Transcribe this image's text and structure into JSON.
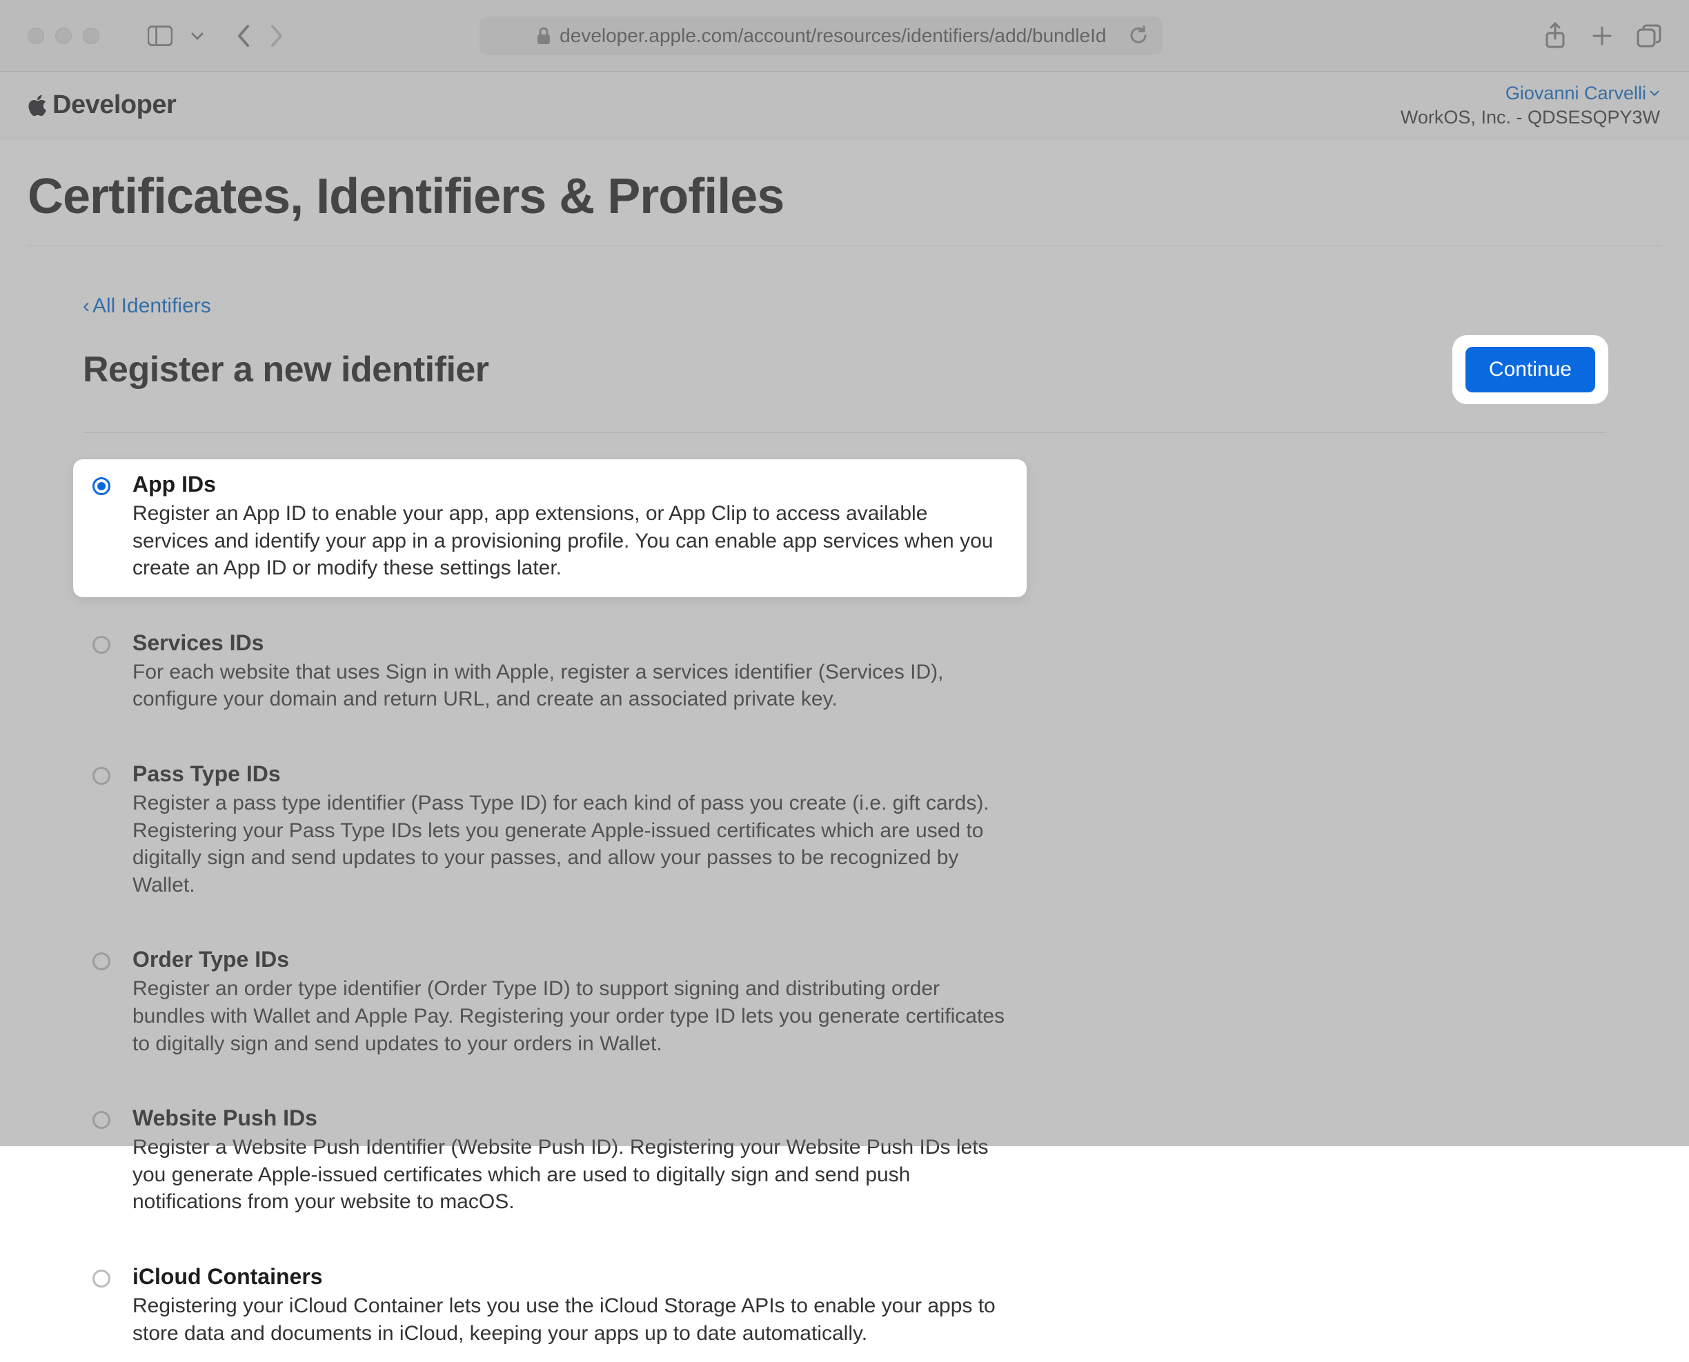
{
  "browser": {
    "url": "developer.apple.com/account/resources/identifiers/add/bundleId"
  },
  "header": {
    "brand": "Developer",
    "account_name": "Giovanni Carvelli",
    "account_org": "WorkOS, Inc. - QDSESQPY3W"
  },
  "page": {
    "title": "Certificates, Identifiers & Profiles",
    "breadcrumb": "All Identifiers",
    "section_title": "Register a new identifier",
    "continue_label": "Continue"
  },
  "options": [
    {
      "title": "App IDs",
      "desc": "Register an App ID to enable your app, app extensions, or App Clip to access available services and identify your app in a provisioning profile. You can enable app services when you create an App ID or modify these settings later.",
      "selected": true
    },
    {
      "title": "Services IDs",
      "desc": "For each website that uses Sign in with Apple, register a services identifier (Services ID), configure your domain and return URL, and create an associated private key.",
      "selected": false
    },
    {
      "title": "Pass Type IDs",
      "desc": "Register a pass type identifier (Pass Type ID) for each kind of pass you create (i.e. gift cards). Registering your Pass Type IDs lets you generate Apple-issued certificates which are used to digitally sign and send updates to your passes, and allow your passes to be recognized by Wallet.",
      "selected": false
    },
    {
      "title": "Order Type IDs",
      "desc": "Register an order type identifier (Order Type ID) to support signing and distributing order bundles with Wallet and Apple Pay. Registering your order type ID lets you generate certificates to digitally sign and send updates to your orders in Wallet.",
      "selected": false
    },
    {
      "title": "Website Push IDs",
      "desc": "Register a Website Push Identifier (Website Push ID). Registering your Website Push IDs lets you generate Apple-issued certificates which are used to digitally sign and send push notifications from your website to macOS.",
      "selected": false
    },
    {
      "title": "iCloud Containers",
      "desc": "Registering your iCloud Container lets you use the iCloud Storage APIs to enable your apps to store data and documents in iCloud, keeping your apps up to date automatically.",
      "selected": false
    }
  ]
}
